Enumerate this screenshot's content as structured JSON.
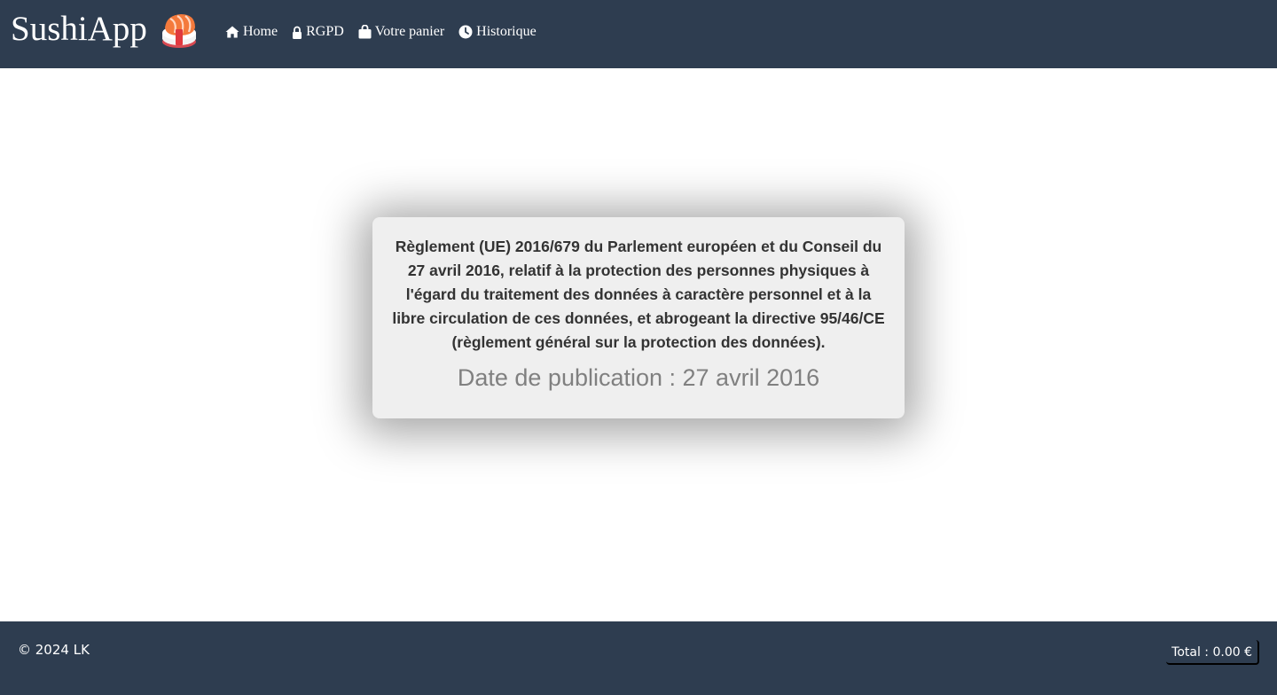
{
  "header": {
    "brand": "SushiApp",
    "nav": [
      {
        "label": "Home",
        "icon": "home-icon"
      },
      {
        "label": "RGPD",
        "icon": "lock-icon"
      },
      {
        "label": "Votre panier",
        "icon": "shopping-bag-icon"
      },
      {
        "label": "Historique",
        "icon": "clock-icon"
      }
    ]
  },
  "card": {
    "title": "Règlement (UE) 2016/679 du Parlement européen et du Conseil du 27 avril 2016, relatif à la protection des personnes physiques à l'égard du traitement des données à caractère personnel et à la libre circulation de ces données, et abrogeant la directive 95/46/CE (règlement général sur la protection des données).",
    "date": "Date de publication : 27 avril 2016"
  },
  "footer": {
    "copyright": "© 2024 LK",
    "total": "Total : 0.00 €"
  },
  "colors": {
    "header_bg": "#2e3d50",
    "card_bg": "#efefef",
    "date_text": "#808080"
  }
}
